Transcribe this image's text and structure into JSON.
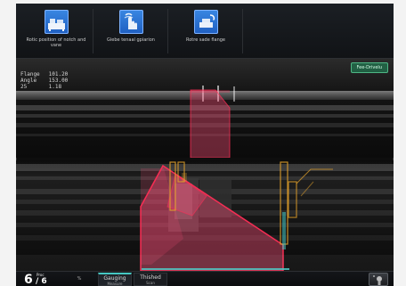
{
  "toolbar": {
    "buttons": [
      {
        "label": "Rotic position of notch and vane"
      },
      {
        "label": "Giebe tenaal gpiarion"
      },
      {
        "label": "Rotre sade flange"
      }
    ]
  },
  "top_view": {
    "badge": "Fee-Drivelu",
    "readout": [
      {
        "key": "Flange",
        "value": "101.20"
      },
      {
        "key": "Angle",
        "value": "153.00"
      },
      {
        "key": "25",
        "value": "1.18"
      }
    ]
  },
  "status_bar": {
    "step_small": "Proc",
    "step_current": "6",
    "step_total": "/ 6",
    "percent": "%",
    "tabs": [
      {
        "title": "Gauging",
        "subtitle": "Measure"
      },
      {
        "title": "Thished",
        "subtitle": "Scan"
      }
    ],
    "active_tab": "Gauging"
  },
  "colors": {
    "overlay_red": "#ff2d55",
    "overlay_fill": "#ff4f7a",
    "guide_orange": "#e4a22b",
    "guide_cyan": "#45c7c2"
  },
  "icons": {
    "tool_1": "machine-icon",
    "tool_2": "gauge-hand-icon",
    "tool_3": "flange-rotate-icon",
    "device": "sensor-device-icon"
  }
}
